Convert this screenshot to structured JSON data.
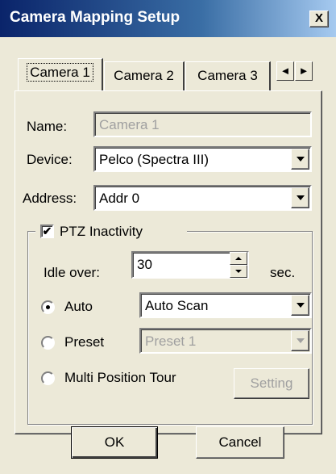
{
  "window": {
    "title": "Camera Mapping Setup",
    "close_label": "X"
  },
  "tabs": [
    {
      "label": "Camera 1",
      "active": true
    },
    {
      "label": "Camera 2",
      "active": false
    },
    {
      "label": "Camera 3",
      "active": false
    }
  ],
  "tab_nav": {
    "prev": "◄",
    "next": "►"
  },
  "form": {
    "name_label": "Name:",
    "name_value": "Camera 1",
    "device_label": "Device:",
    "device_value": "Pelco (Spectra III)",
    "address_label": "Address:",
    "address_value": "Addr 0"
  },
  "ptz": {
    "checkbox_label": "PTZ Inactivity",
    "checked": true,
    "checkmark": "✔",
    "idle_label": "Idle over:",
    "idle_value": "30",
    "idle_unit": "sec.",
    "auto_label": "Auto",
    "auto_value": "Auto Scan",
    "preset_label": "Preset",
    "preset_value": "Preset 1",
    "tour_label": "Multi Position Tour",
    "setting_label": "Setting",
    "selected_mode": "Auto"
  },
  "footer": {
    "ok_label": "OK",
    "cancel_label": "Cancel"
  }
}
